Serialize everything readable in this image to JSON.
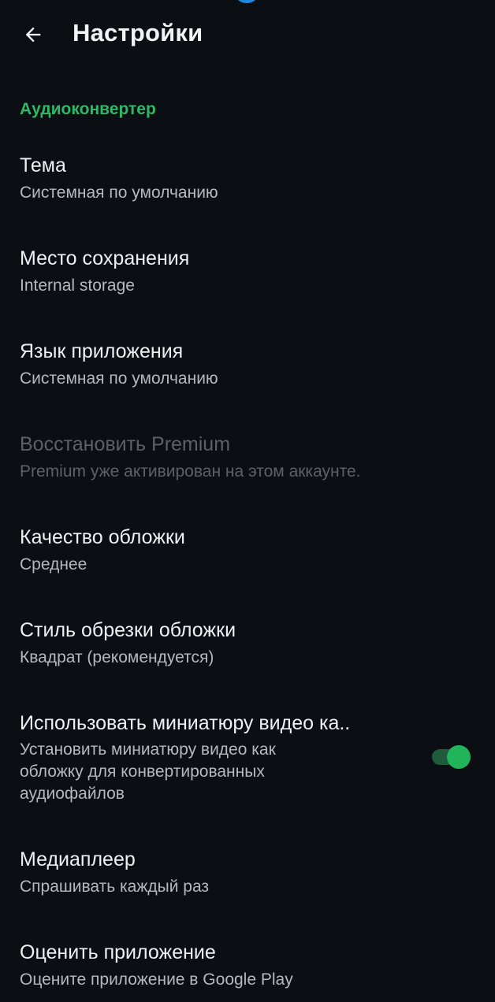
{
  "app_bar": {
    "title": "Настройки",
    "back_icon": "arrow-back-icon"
  },
  "section": {
    "title": "Аудиоконвертер",
    "color": "#2fb866"
  },
  "preferences": [
    {
      "title": "Тема",
      "summary": "Системная по умолчанию",
      "enabled": true
    },
    {
      "title": "Место сохранения",
      "summary": "Internal storage",
      "enabled": true
    },
    {
      "title": "Язык приложения",
      "summary": "Системная по умолчанию",
      "enabled": true
    },
    {
      "title": "Восстановить Premium",
      "summary": "Premium уже активирован на этом аккаунте.",
      "enabled": false
    },
    {
      "title": "Качество обложки",
      "summary": "Среднее",
      "enabled": true
    },
    {
      "title": "Стиль обрезки обложки",
      "summary": "Квадрат (рекомендуется)",
      "enabled": true
    },
    {
      "title": "Использовать миниатюру видео ка..",
      "summary_lines": [
        "Установить миниатюру видео как",
        "обложку для конвертированных",
        "аудиофайлов"
      ],
      "enabled": true,
      "switch_on": true
    },
    {
      "title": "Медиаплеер",
      "summary": "Спрашивать каждый раз",
      "enabled": true
    },
    {
      "title": "Оценить приложение",
      "summary": "Оцените приложение в Google Play",
      "enabled": true
    }
  ],
  "colors": {
    "background": "#0b0f14",
    "accent": "#22b45a",
    "switch_track": "#1f5b3c",
    "disabled_text": "#5c6167"
  }
}
